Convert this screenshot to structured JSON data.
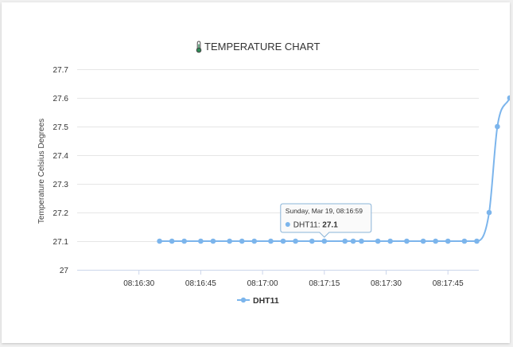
{
  "chart_data": {
    "type": "line",
    "title": "TEMPERATURE CHART",
    "title_icon": "thermometer-icon",
    "xlabel": "",
    "ylabel": "Temperature Celsius Degrees",
    "ylim": [
      27,
      27.7
    ],
    "yticks": [
      "27",
      "27.1",
      "27.2",
      "27.3",
      "27.4",
      "27.5",
      "27.6",
      "27.7"
    ],
    "xticks": [
      "08:16:30",
      "08:16:45",
      "08:17:00",
      "08:17:15",
      "08:17:30",
      "08:17:45"
    ],
    "x_seconds": [
      20,
      23,
      26,
      30,
      33,
      37,
      40,
      43,
      47,
      50,
      53,
      57,
      60,
      65,
      67,
      69,
      73,
      76,
      80,
      84,
      87,
      90,
      94,
      97,
      100,
      102,
      105
    ],
    "grid": true,
    "legend_placement": "bottom-center",
    "series": [
      {
        "name": "DHT11",
        "color": "#7cb5ec",
        "values": [
          27.1,
          27.1,
          27.1,
          27.1,
          27.1,
          27.1,
          27.1,
          27.1,
          27.1,
          27.1,
          27.1,
          27.1,
          27.1,
          27.1,
          27.1,
          27.1,
          27.1,
          27.1,
          27.1,
          27.1,
          27.1,
          27.1,
          27.1,
          27.1,
          27.2,
          27.5,
          27.6
        ]
      }
    ],
    "tooltip": {
      "header": "Sunday, Mar 19, 08:16:59",
      "series_name": "DHT11",
      "value": "27.1",
      "point_index": 12
    }
  }
}
